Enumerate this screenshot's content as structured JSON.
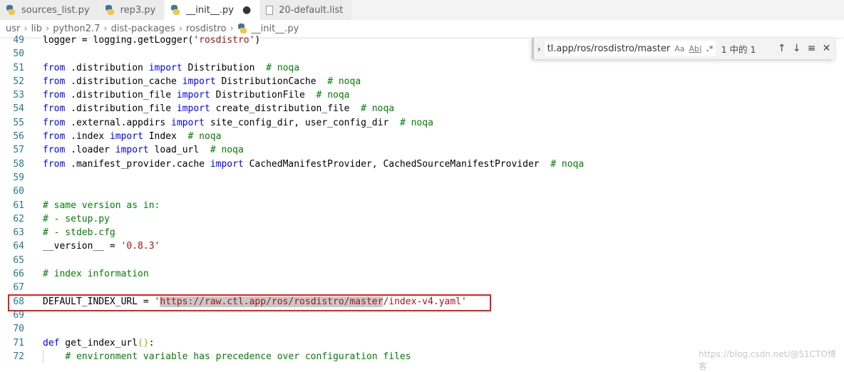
{
  "tabs": [
    {
      "label": "sources_list.py",
      "icon": "python-icon",
      "active": false,
      "dirty": false
    },
    {
      "label": "rep3.py",
      "icon": "python-icon",
      "active": false,
      "dirty": false
    },
    {
      "label": "__init__.py",
      "icon": "python-icon",
      "active": true,
      "dirty": true
    },
    {
      "label": "20-default.list",
      "icon": "file-icon",
      "active": false,
      "dirty": false
    }
  ],
  "breadcrumb": [
    "usr",
    "lib",
    "python2.7",
    "dist-packages",
    "rosdistro",
    "__init__.py"
  ],
  "find": {
    "value": "tl.app/ros/rosdistro/master",
    "match_case": "Aa",
    "whole_word": "Ab|",
    "regex": ".*",
    "count": "1 中的 1",
    "prev": "↑",
    "next": "↓",
    "selection": "≡",
    "close": "✕"
  },
  "code": [
    {
      "n": "49",
      "t": [
        [
          "",
          "logger = logging.getLogger("
        ],
        [
          "st",
          "'rosdistro'"
        ],
        [
          "",
          ")"
        ]
      ]
    },
    {
      "n": "50",
      "t": []
    },
    {
      "n": "51",
      "t": [
        [
          "kw",
          "from"
        ],
        [
          "",
          " .distribution "
        ],
        [
          "kw",
          "import"
        ],
        [
          "",
          " Distribution  "
        ],
        [
          "cm",
          "# noqa"
        ]
      ]
    },
    {
      "n": "52",
      "t": [
        [
          "kw",
          "from"
        ],
        [
          "",
          " .distribution_cache "
        ],
        [
          "kw",
          "import"
        ],
        [
          "",
          " DistributionCache  "
        ],
        [
          "cm",
          "# noqa"
        ]
      ]
    },
    {
      "n": "53",
      "t": [
        [
          "kw",
          "from"
        ],
        [
          "",
          " .distribution_file "
        ],
        [
          "kw",
          "import"
        ],
        [
          "",
          " DistributionFile  "
        ],
        [
          "cm",
          "# noqa"
        ]
      ]
    },
    {
      "n": "54",
      "t": [
        [
          "kw",
          "from"
        ],
        [
          "",
          " .distribution_file "
        ],
        [
          "kw",
          "import"
        ],
        [
          "",
          " create_distribution_file  "
        ],
        [
          "cm",
          "# noqa"
        ]
      ]
    },
    {
      "n": "55",
      "t": [
        [
          "kw",
          "from"
        ],
        [
          "",
          " .external.appdirs "
        ],
        [
          "kw",
          "import"
        ],
        [
          "",
          " site_config_dir, user_config_dir  "
        ],
        [
          "cm",
          "# noqa"
        ]
      ]
    },
    {
      "n": "56",
      "t": [
        [
          "kw",
          "from"
        ],
        [
          "",
          " .index "
        ],
        [
          "kw",
          "import"
        ],
        [
          "",
          " Index  "
        ],
        [
          "cm",
          "# noqa"
        ]
      ]
    },
    {
      "n": "57",
      "t": [
        [
          "kw",
          "from"
        ],
        [
          "",
          " .loader "
        ],
        [
          "kw",
          "import"
        ],
        [
          "",
          " load_url  "
        ],
        [
          "cm",
          "# noqa"
        ]
      ]
    },
    {
      "n": "58",
      "t": [
        [
          "kw",
          "from"
        ],
        [
          "",
          " .manifest_provider.cache "
        ],
        [
          "kw",
          "import"
        ],
        [
          "",
          " CachedManifestProvider, CachedSourceManifestProvider  "
        ],
        [
          "cm",
          "# noqa"
        ]
      ]
    },
    {
      "n": "59",
      "t": []
    },
    {
      "n": "60",
      "t": []
    },
    {
      "n": "61",
      "t": [
        [
          "cm",
          "# same version as in:"
        ]
      ]
    },
    {
      "n": "62",
      "t": [
        [
          "cm",
          "# - setup.py"
        ]
      ]
    },
    {
      "n": "63",
      "t": [
        [
          "cm",
          "# - stdeb.cfg"
        ]
      ]
    },
    {
      "n": "64",
      "t": [
        [
          "",
          "__version__ = "
        ],
        [
          "st",
          "'0.8.3'"
        ]
      ]
    },
    {
      "n": "65",
      "t": []
    },
    {
      "n": "66",
      "t": [
        [
          "cm",
          "# index information"
        ]
      ]
    },
    {
      "n": "67",
      "t": []
    },
    {
      "n": "68",
      "t": [
        [
          "",
          "DEFAULT_INDEX_URL = "
        ],
        [
          "st",
          "'"
        ],
        [
          "cursor",
          ""
        ],
        [
          "st sel",
          "https://raw.ctl.app/ros/rosdistro/master"
        ],
        [
          "st",
          "/index-v4.yaml'"
        ]
      ]
    },
    {
      "n": "69",
      "t": []
    },
    {
      "n": "70",
      "t": []
    },
    {
      "n": "71",
      "t": [
        [
          "kw",
          "def"
        ],
        [
          "",
          " get_index_url"
        ],
        [
          "pn",
          "()"
        ],
        [
          "",
          ":"
        ]
      ]
    },
    {
      "n": "72",
      "t": [
        [
          "",
          "    "
        ],
        [
          "cm",
          "# environment variable has precedence over configuration files"
        ]
      ]
    }
  ],
  "watermark": "https://blog.csdn.net/@51CTO博客",
  "colors": {
    "keyword": "#0000ff",
    "comment": "#008000",
    "string": "#a31515",
    "line_number": "#237893",
    "highlight_box": "#e02020"
  }
}
